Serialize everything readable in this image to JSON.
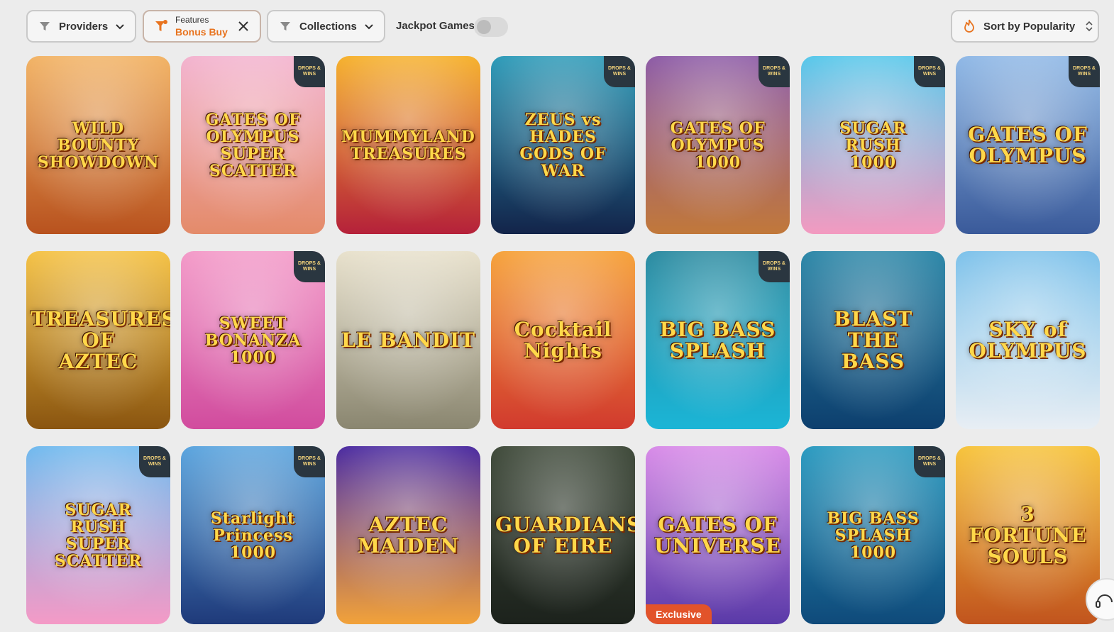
{
  "filters": {
    "providers_label": "Providers",
    "features_caption": "Features",
    "features_value": "Bonus Buy",
    "collections_label": "Collections",
    "jackpot_label": "Jackpot Games",
    "jackpot_on": false,
    "sort_label": "Sort by Popularity"
  },
  "colors": {
    "accent": "#e8731e",
    "exclusive": "#e2532a",
    "badge_bg": "#2a3640"
  },
  "badge_text": "DROPS & WINS",
  "games": [
    {
      "title": "WILD BOUNTY\nSHOWDOWN",
      "badge": false,
      "bg": [
        "#f2b365",
        "#b8521e"
      ],
      "exclusive": false
    },
    {
      "title": "GATES OF\nOLYMPUS\nSUPER SCATTER",
      "badge": true,
      "bg": [
        "#f3b3cf",
        "#e48b6a"
      ],
      "exclusive": false
    },
    {
      "title": "MUMMYLAND\nTREASURES",
      "badge": false,
      "bg": [
        "#f6b12c",
        "#b5213a"
      ],
      "exclusive": false
    },
    {
      "title": "ZEUS vs HADES\nGODS OF WAR",
      "badge": true,
      "bg": [
        "#2c9ab8",
        "#13244a"
      ],
      "exclusive": false
    },
    {
      "title": "GATES OF\nOLYMPUS\n1000",
      "badge": true,
      "bg": [
        "#8c5aa6",
        "#c1783a"
      ],
      "exclusive": false
    },
    {
      "title": "SUGAR\nRUSH\n1000",
      "badge": true,
      "bg": [
        "#55c7ea",
        "#f39ac0"
      ],
      "exclusive": false
    },
    {
      "title": "GATES OF OLYMPUS",
      "badge": true,
      "bg": [
        "#8fb8e6",
        "#3a5a9a"
      ],
      "exclusive": false
    },
    {
      "title": "TREASURES OF\nAZTEC",
      "badge": false,
      "bg": [
        "#f5c245",
        "#8a5510"
      ],
      "exclusive": false
    },
    {
      "title": "SWEET\nBONANZA\n1000",
      "badge": true,
      "bg": [
        "#f39ac8",
        "#d14c9e"
      ],
      "exclusive": false
    },
    {
      "title": "LE BANDIT",
      "badge": false,
      "bg": [
        "#e8e1cc",
        "#8a8670"
      ],
      "exclusive": false
    },
    {
      "title": "Cocktail\nNights",
      "badge": false,
      "bg": [
        "#f6a23a",
        "#d13a2e"
      ],
      "exclusive": false
    },
    {
      "title": "BIG BASS\nSPLASH",
      "badge": true,
      "bg": [
        "#2a8aa0",
        "#1bb5d6"
      ],
      "exclusive": false
    },
    {
      "title": "BLAST THE\nBASS",
      "badge": false,
      "bg": [
        "#2c87a8",
        "#0d3f6e"
      ],
      "exclusive": false
    },
    {
      "title": "SKY of\nOLYMPUS",
      "badge": false,
      "bg": [
        "#7cc1ea",
        "#e8eef4"
      ],
      "exclusive": false
    },
    {
      "title": "SUGAR\nRUSH\nSUPER SCATTER",
      "badge": true,
      "bg": [
        "#6fb9ee",
        "#f49ac6"
      ],
      "exclusive": false
    },
    {
      "title": "Starlight\nPrincess\n1000",
      "badge": true,
      "bg": [
        "#5aa4de",
        "#1f3a7a"
      ],
      "exclusive": false
    },
    {
      "title": "AZTEC\nMAIDEN",
      "badge": false,
      "bg": [
        "#4a2aa0",
        "#f2a23a"
      ],
      "exclusive": false
    },
    {
      "title": "GUARDIANS\nOF EIRE",
      "badge": false,
      "bg": [
        "#3f4a3a",
        "#1c221c"
      ],
      "exclusive": false
    },
    {
      "title": "GATES OF\nUNIVERSE",
      "badge": false,
      "bg": [
        "#d88be8",
        "#5a3aa8"
      ],
      "exclusive": true,
      "exclusive_label": "Exclusive"
    },
    {
      "title": "BIG BASS\nSPLASH\n1000",
      "badge": true,
      "bg": [
        "#2a9ac0",
        "#0f4a7a"
      ],
      "exclusive": false
    },
    {
      "title": "3 FORTUNE\nSOULS",
      "badge": false,
      "bg": [
        "#f7c33a",
        "#c1541e"
      ],
      "exclusive": false
    }
  ]
}
